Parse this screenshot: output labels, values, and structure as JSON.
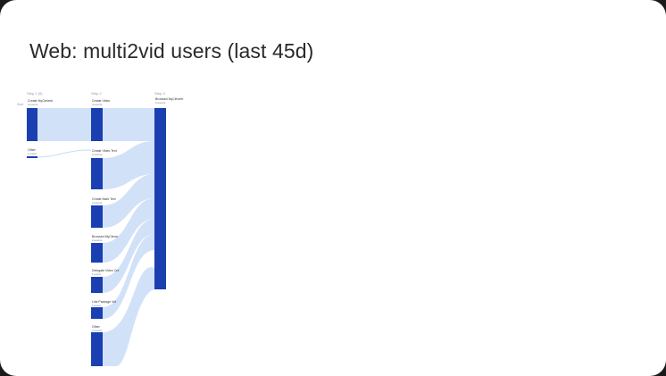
{
  "title": "Web: multi2vid users (last 45d)",
  "colors": {
    "node": "#1a3fb0",
    "link": "#c9dcf7",
    "background": "#ffffff"
  },
  "steps": [
    "Step 1 (5)",
    "Step 2",
    "Step 3"
  ],
  "side_label": "Start",
  "nodes": {
    "a1": {
      "label": "Create MyCleverb",
      "sub": "3 events"
    },
    "a2": {
      "label": "Other",
      "sub": "1 event"
    },
    "b1": {
      "label": "Create Video",
      "sub": "3 events"
    },
    "b2": {
      "label": "Create Video Text",
      "sub": "2 events"
    },
    "b3": {
      "label": "Create Mark Text",
      "sub": "2 events"
    },
    "b4": {
      "label": "Browsed MyClever",
      "sub": "2 events"
    },
    "b5": {
      "label": "Delegate Video Cre",
      "sub": "1 event"
    },
    "b6": {
      "label": "Link Package Vid",
      "sub": "1 event"
    },
    "b7": {
      "label": "Other",
      "sub": "2 events"
    },
    "c1": {
      "label": "Browsed MyCleverb",
      "sub": "6 events"
    }
  }
}
